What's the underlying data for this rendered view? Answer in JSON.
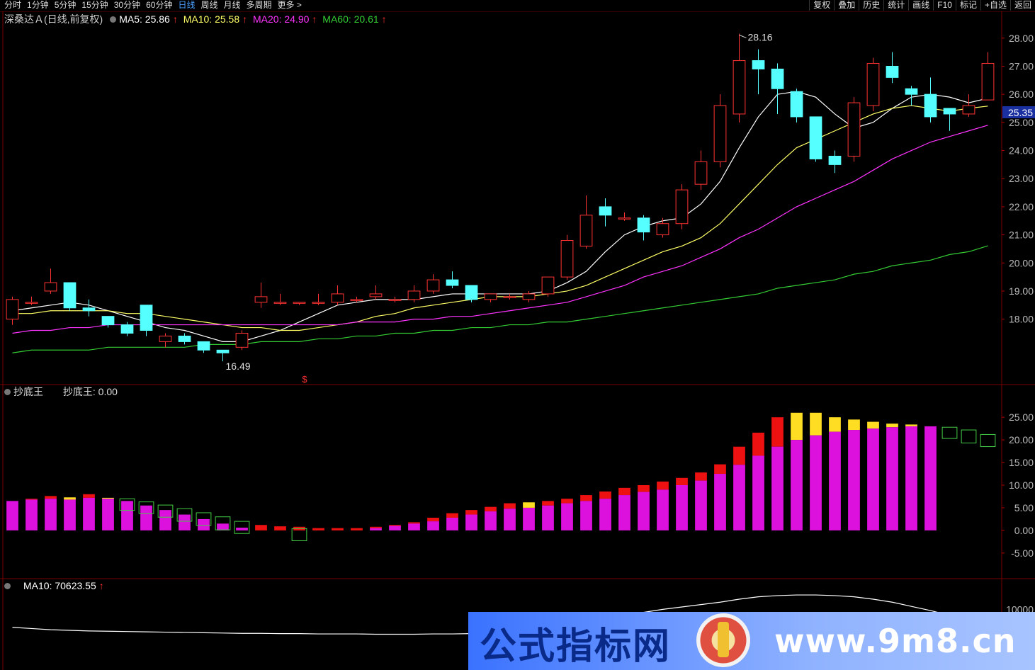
{
  "toolbar": {
    "tabs": [
      "分时",
      "1分钟",
      "5分钟",
      "15分钟",
      "30分钟",
      "60分钟",
      "日线",
      "周线",
      "月线",
      "多周期",
      "更多 >"
    ],
    "active_tab": "日线",
    "tools": [
      "复权",
      "叠加",
      "历史",
      "统计",
      "画线",
      "F10",
      "标记",
      "+自选",
      "返回"
    ]
  },
  "main_panel": {
    "title": "深桑达Ａ(日线,前复权)",
    "ma5": "MA5: 25.86",
    "ma10": "MA10: 25.58",
    "ma20": "MA20: 24.90",
    "ma60": "MA60: 20.61",
    "up_arrow": "↑",
    "high_label": "28.16",
    "low_label": "16.49",
    "price_tag": "25.35",
    "marker": "$",
    "colors": {
      "ma5": "#ffffff",
      "ma10": "#ffff66",
      "ma20": "#ff33ff",
      "ma60": "#33cc33",
      "up": "#ff3333",
      "down": "#55ffff",
      "price_tag_bg": "#1a2fa0"
    }
  },
  "indicator_panel": {
    "title": "抄底王",
    "value_label": "抄底王: 0.00"
  },
  "volume_panel": {
    "ma10": "MA10: 70623.55",
    "axis_label": "10000"
  },
  "watermark": {
    "cn": "公式指标网",
    "en": "www.9m8.cn"
  },
  "chart_data": [
    {
      "type": "candlestick",
      "title": "深桑达Ａ(日线,前复权)",
      "y_ticks": [
        "28.00",
        "27.00",
        "26.00",
        "25.00",
        "24.00",
        "23.00",
        "22.00",
        "21.00",
        "20.00",
        "19.00",
        "18.00"
      ],
      "ylim": [
        16.0,
        28.6
      ],
      "candles": [
        [
          18.0,
          18.7,
          17.8,
          18.8
        ],
        [
          18.6,
          18.6,
          18.5,
          18.8
        ],
        [
          19.0,
          19.3,
          18.9,
          19.8
        ],
        [
          19.3,
          18.4,
          18.3,
          19.3
        ],
        [
          18.4,
          18.3,
          18.1,
          18.7
        ],
        [
          18.1,
          17.8,
          17.7,
          18.1
        ],
        [
          17.8,
          17.5,
          17.4,
          17.9
        ],
        [
          18.5,
          17.6,
          17.4,
          18.5
        ],
        [
          17.2,
          17.4,
          17.0,
          17.5
        ],
        [
          17.4,
          17.2,
          17.1,
          17.5
        ],
        [
          17.2,
          16.9,
          16.8,
          17.2
        ],
        [
          16.9,
          16.8,
          16.5,
          16.9
        ],
        [
          17.0,
          17.5,
          16.9,
          17.6
        ],
        [
          18.6,
          18.8,
          18.4,
          19.3
        ],
        [
          18.6,
          18.6,
          18.5,
          18.9
        ],
        [
          18.6,
          18.6,
          18.5,
          18.6
        ],
        [
          18.6,
          18.6,
          18.5,
          18.9
        ],
        [
          18.6,
          18.9,
          18.5,
          19.2
        ],
        [
          18.7,
          18.7,
          18.6,
          18.8
        ],
        [
          18.8,
          18.9,
          18.7,
          19.2
        ],
        [
          18.7,
          18.7,
          18.6,
          18.8
        ],
        [
          18.7,
          19.0,
          18.6,
          19.2
        ],
        [
          19.0,
          19.4,
          18.9,
          19.6
        ],
        [
          19.4,
          19.2,
          19.1,
          19.7
        ],
        [
          19.2,
          18.7,
          18.6,
          19.2
        ],
        [
          18.7,
          18.9,
          18.6,
          18.9
        ],
        [
          18.8,
          18.8,
          18.7,
          18.9
        ],
        [
          18.7,
          18.9,
          18.6,
          19.0
        ],
        [
          18.9,
          19.5,
          18.8,
          19.5
        ],
        [
          19.5,
          20.8,
          19.4,
          21.0
        ],
        [
          20.6,
          21.7,
          20.5,
          22.4
        ],
        [
          22.0,
          21.7,
          21.3,
          22.3
        ],
        [
          21.6,
          21.6,
          21.5,
          21.8
        ],
        [
          21.6,
          21.1,
          20.8,
          21.7
        ],
        [
          21.0,
          21.4,
          20.9,
          21.6
        ],
        [
          21.4,
          22.6,
          21.2,
          22.8
        ],
        [
          22.8,
          23.6,
          22.6,
          24.0
        ],
        [
          23.6,
          25.6,
          23.4,
          26.0
        ],
        [
          25.3,
          27.2,
          25.0,
          28.16
        ],
        [
          27.2,
          26.9,
          26.0,
          27.6
        ],
        [
          26.9,
          26.2,
          25.3,
          27.1
        ],
        [
          26.1,
          25.2,
          25.0,
          26.2
        ],
        [
          25.2,
          23.7,
          23.6,
          25.2
        ],
        [
          23.8,
          23.5,
          23.2,
          24.0
        ],
        [
          23.8,
          25.7,
          23.6,
          25.9
        ],
        [
          25.6,
          27.1,
          25.4,
          27.3
        ],
        [
          27.0,
          26.6,
          26.4,
          27.5
        ],
        [
          26.2,
          26.0,
          25.6,
          26.3
        ],
        [
          26.0,
          25.2,
          25.0,
          26.6
        ],
        [
          25.5,
          25.3,
          24.7,
          25.5
        ],
        [
          25.3,
          25.6,
          25.2,
          26.0
        ],
        [
          25.8,
          27.1,
          25.8,
          27.5
        ]
      ],
      "series": [
        {
          "name": "MA5",
          "values": [
            18.3,
            18.4,
            18.5,
            18.6,
            18.5,
            18.3,
            18.1,
            17.9,
            17.7,
            17.6,
            17.4,
            17.2,
            17.2,
            17.4,
            17.6,
            17.9,
            18.2,
            18.5,
            18.6,
            18.7,
            18.7,
            18.7,
            18.8,
            18.9,
            18.9,
            18.9,
            18.9,
            18.9,
            19.0,
            19.3,
            19.7,
            20.4,
            21.0,
            21.3,
            21.5,
            21.6,
            22.1,
            22.9,
            24.1,
            25.2,
            26.0,
            26.1,
            25.9,
            25.3,
            24.8,
            25.0,
            25.5,
            25.9,
            26.0,
            25.9,
            25.7,
            25.86
          ]
        },
        {
          "name": "MA10",
          "values": [
            18.2,
            18.2,
            18.3,
            18.3,
            18.3,
            18.3,
            18.2,
            18.2,
            18.1,
            18.0,
            17.9,
            17.8,
            17.7,
            17.7,
            17.6,
            17.6,
            17.7,
            17.8,
            17.9,
            18.1,
            18.2,
            18.4,
            18.5,
            18.6,
            18.7,
            18.8,
            18.8,
            18.8,
            18.9,
            19.0,
            19.2,
            19.5,
            19.8,
            20.1,
            20.4,
            20.6,
            20.9,
            21.4,
            22.1,
            22.8,
            23.5,
            24.1,
            24.4,
            24.7,
            25.0,
            25.3,
            25.5,
            25.6,
            25.5,
            25.4,
            25.5,
            25.58
          ]
        },
        {
          "name": "MA20",
          "values": [
            17.5,
            17.6,
            17.6,
            17.7,
            17.7,
            17.8,
            17.8,
            17.8,
            17.8,
            17.8,
            17.8,
            17.8,
            17.8,
            17.8,
            17.8,
            17.8,
            17.8,
            17.8,
            17.9,
            17.9,
            17.9,
            18.0,
            18.0,
            18.1,
            18.1,
            18.2,
            18.3,
            18.4,
            18.5,
            18.6,
            18.8,
            19.0,
            19.2,
            19.5,
            19.7,
            19.9,
            20.2,
            20.5,
            20.9,
            21.2,
            21.6,
            22.0,
            22.3,
            22.6,
            22.9,
            23.3,
            23.7,
            24.0,
            24.3,
            24.5,
            24.7,
            24.9
          ]
        },
        {
          "name": "MA60",
          "values": [
            16.8,
            16.9,
            16.9,
            16.9,
            16.9,
            17.0,
            17.0,
            17.0,
            17.0,
            17.0,
            17.1,
            17.1,
            17.1,
            17.2,
            17.2,
            17.2,
            17.3,
            17.3,
            17.4,
            17.4,
            17.5,
            17.5,
            17.6,
            17.6,
            17.7,
            17.7,
            17.8,
            17.8,
            17.9,
            17.9,
            18.0,
            18.1,
            18.2,
            18.3,
            18.4,
            18.5,
            18.6,
            18.7,
            18.8,
            18.9,
            19.1,
            19.2,
            19.3,
            19.4,
            19.6,
            19.7,
            19.9,
            20.0,
            20.1,
            20.3,
            20.4,
            20.61
          ]
        }
      ]
    },
    {
      "type": "bar",
      "title": "抄底王",
      "y_ticks": [
        "25.00",
        "20.00",
        "15.00",
        "10.00",
        "5.00",
        "0.00",
        "-5.00"
      ],
      "ylim": [
        -8,
        28
      ],
      "base_values": [
        6.5,
        6.8,
        7.0,
        6.8,
        7.2,
        7.0,
        6.5,
        5.5,
        4.5,
        3.5,
        2.5,
        1.5,
        0.6,
        0.0,
        0.0,
        0.0,
        0.0,
        0.0,
        0.0,
        0.5,
        1.0,
        1.5,
        2.0,
        2.8,
        3.5,
        4.2,
        4.8,
        5.0,
        5.5,
        6.0,
        6.5,
        7.0,
        7.8,
        8.5,
        9.0,
        10.0,
        11.0,
        12.5,
        14.5,
        16.5,
        18.5,
        20.0,
        21.0,
        21.8,
        22.2,
        22.5,
        22.8,
        23.0,
        23.0,
        0,
        0,
        0
      ],
      "top_values": [
        6.5,
        7.0,
        7.6,
        7.3,
        8.0,
        7.2,
        6.5,
        5.5,
        4.5,
        3.5,
        2.5,
        1.5,
        0.6,
        1.2,
        0.9,
        0.8,
        0.5,
        0.5,
        0.5,
        0.8,
        1.2,
        1.8,
        2.8,
        3.8,
        4.5,
        5.2,
        6.0,
        6.2,
        6.5,
        7.0,
        7.8,
        8.6,
        9.4,
        10.0,
        10.8,
        11.6,
        12.8,
        14.6,
        18.5,
        21.6,
        25.0,
        26.0,
        26.0,
        25.0,
        24.5,
        24.0,
        23.6,
        23.4,
        23.0,
        0,
        0,
        0
      ],
      "hollow_values": [
        0,
        0,
        0,
        0,
        0,
        0,
        7.0,
        6.3,
        5.6,
        4.8,
        3.9,
        3.0,
        2.0,
        0,
        0,
        0.4,
        0,
        0,
        0,
        0,
        0,
        0,
        0,
        0,
        0,
        0,
        0,
        0,
        0,
        0,
        0,
        0,
        0,
        0,
        0,
        0,
        0,
        0,
        0,
        0,
        0,
        0,
        0,
        0,
        0,
        0,
        0,
        0,
        0,
        22.8,
        22.2,
        21.2
      ],
      "yellow_flags": [
        0,
        0,
        0,
        1,
        0,
        1,
        0,
        0,
        0,
        0,
        0,
        0,
        0,
        0,
        0,
        0,
        0,
        0,
        0,
        0,
        0,
        0,
        0,
        0,
        0,
        0,
        0,
        1,
        0,
        0,
        0,
        0,
        0,
        0,
        0,
        0,
        0,
        0,
        0,
        0,
        0,
        1,
        1,
        1,
        1,
        1,
        1,
        1,
        1,
        0,
        0,
        0
      ]
    },
    {
      "type": "line",
      "title": "MA10: 70623.55",
      "series": [
        {
          "name": "MA10",
          "values": [
            70000,
            68000,
            66000,
            65000,
            64000,
            63500,
            63000,
            62500,
            62000,
            61500,
            61000,
            60500,
            60000,
            60000,
            59500,
            59500,
            59000,
            59000,
            59000,
            58500,
            58500,
            58500,
            59000,
            59000,
            59500,
            60000,
            61000,
            62000,
            64000,
            68000,
            73000,
            80000,
            88000,
            95000,
            100000,
            104000,
            108000,
            112000,
            117000,
            121000,
            123000,
            124000,
            124000,
            123000,
            121000,
            117000,
            112000,
            105000,
            98000,
            90000,
            82000,
            70623.55
          ]
        }
      ],
      "ylim": [
        0,
        130000
      ]
    }
  ]
}
